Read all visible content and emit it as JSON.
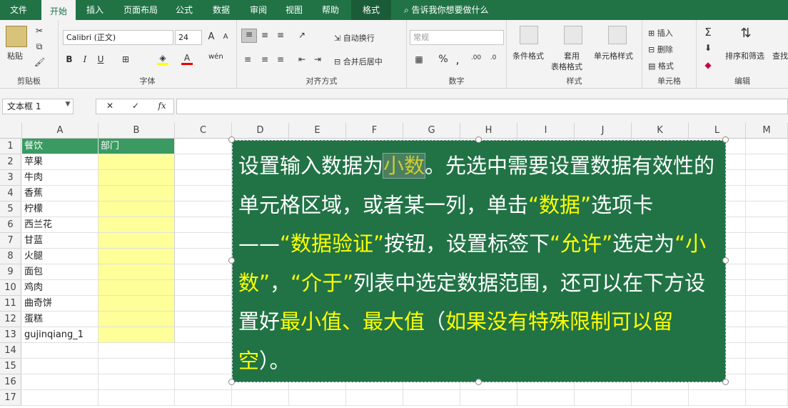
{
  "tabs": {
    "file": "文件",
    "home": "开始",
    "insert": "插入",
    "layout": "页面布局",
    "formulas": "公式",
    "data": "数据",
    "review": "审阅",
    "view": "视图",
    "help": "帮助",
    "format": "格式"
  },
  "tellme": "告诉我你想要做什么",
  "ribbon": {
    "clipboard": {
      "paste": "粘贴",
      "label": "剪贴板"
    },
    "font": {
      "name": "Calibri (正文)",
      "size": "24",
      "bold": "B",
      "italic": "I",
      "underline": "U",
      "grow": "A",
      "shrink": "A",
      "label": "字体"
    },
    "alignment": {
      "wrap": "自动换行",
      "merge": "合并后居中",
      "label": "对齐方式"
    },
    "number": {
      "format": "常规",
      "percent": "%",
      "comma": ",",
      "label": "数字"
    },
    "styles": {
      "conditional": "条件格式",
      "table_line1": "套用",
      "table_line2": "表格格式",
      "cell_styles": "单元格样式",
      "label": "样式"
    },
    "cells": {
      "insert": "插入",
      "delete": "删除",
      "format": "格式",
      "label": "单元格"
    },
    "editing": {
      "sort": "排序和筛选",
      "find": "查找",
      "label": "编辑"
    }
  },
  "formula_bar": {
    "name_box": "文本框 1",
    "fx": "fx",
    "value": ""
  },
  "columns": [
    "A",
    "B",
    "C",
    "D",
    "E",
    "F",
    "G",
    "H",
    "I",
    "J",
    "K",
    "L",
    "M"
  ],
  "rows": [
    "1",
    "2",
    "3",
    "4",
    "5",
    "6",
    "7",
    "8",
    "9",
    "10",
    "11",
    "12",
    "13",
    "14",
    "15",
    "16",
    "17"
  ],
  "cells": {
    "A1": "餐饮",
    "B1": "部门",
    "A": [
      "苹果",
      "牛肉",
      "香蕉",
      "柠檬",
      "西兰花",
      "甘蓝",
      "火腿",
      "面包",
      "鸡肉",
      "曲奇饼",
      "蛋糕",
      "gujinqiang_1"
    ]
  },
  "textbox": {
    "p1": "设置输入数据为",
    "p2": "小数",
    "p3": "。先选中需要设置数据有效性的单元格区域，或者某一列，单击",
    "p4": "“数据”",
    "p5": "选项卡——",
    "p6": "“数据验证”",
    "p7": "按钮，设置标签下",
    "p8": "“允许”",
    "p9": "选定为",
    "p10": "“小数”",
    "p11": "，",
    "p12": "“介于”",
    "p13": "列表中选定数据范围，还可以在下方设置好",
    "p14": "最小值、最大值",
    "p15": "（",
    "p16": "如果没有特殊限制可以留空",
    "p17": "）。"
  },
  "colors": {
    "excel_green": "#217346",
    "header_fill": "#3a9a62",
    "input_fill": "#ffff99",
    "highlight": "#ffff00"
  }
}
